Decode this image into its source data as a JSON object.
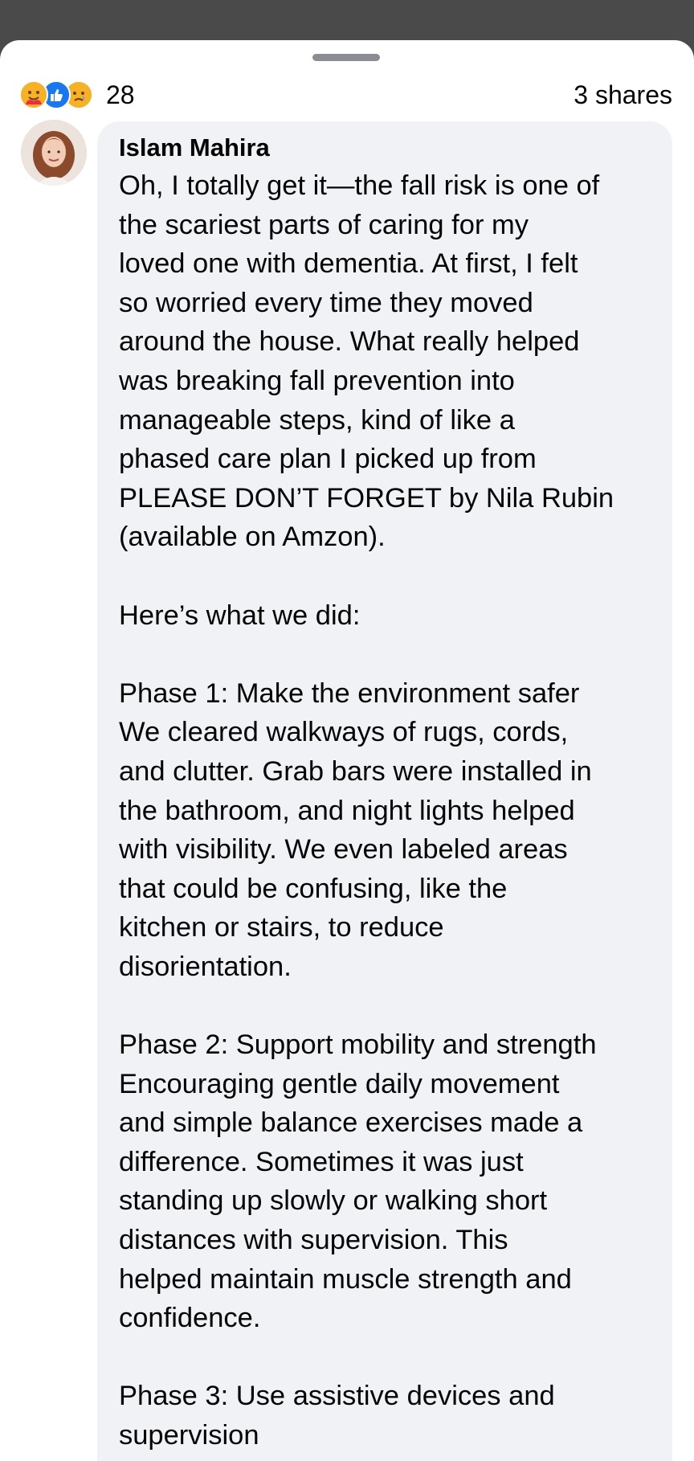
{
  "reactions": {
    "icons": [
      "care-reaction-icon",
      "like-reaction-icon",
      "sad-reaction-icon"
    ],
    "count": "28",
    "shares": "3 shares"
  },
  "comment": {
    "author": "Islam Mahira",
    "lines": [
      "Oh, I totally get it—the fall risk is one of",
      "the scariest parts of caring for my",
      "loved one with dementia. At first, I felt",
      "so worried every time they moved",
      "around the house. What really helped",
      "was breaking fall prevention into",
      "manageable steps, kind of like a",
      "phased care plan I picked up from",
      "PLEASE DON’T FORGET by Nila Rubin",
      "(available on Amzon).",
      "",
      "Here’s what we did:",
      "",
      "Phase 1: Make the environment safer",
      "We cleared walkways of rugs, cords,",
      "and clutter. Grab bars were installed in",
      "the bathroom, and night lights helped",
      "with visibility. We even labeled areas",
      "that could be confusing, like the",
      "kitchen or stairs, to reduce",
      "disorientation.",
      "",
      "Phase 2: Support mobility and strength",
      "Encouraging gentle daily movement",
      "and simple balance exercises made a",
      "difference. Sometimes it was just",
      "standing up slowly or walking short",
      "distances with supervision. This",
      "helped maintain muscle strength and",
      "confidence.",
      "",
      "Phase 3: Use assistive devices and",
      "supervision"
    ]
  },
  "colors": {
    "backdrop": "#4a4a4a",
    "sheet": "#ffffff",
    "bubble": "#f0f2f5",
    "like_blue": "#1877f2",
    "emoji_yellow": "#f7b125",
    "text": "#050505"
  }
}
